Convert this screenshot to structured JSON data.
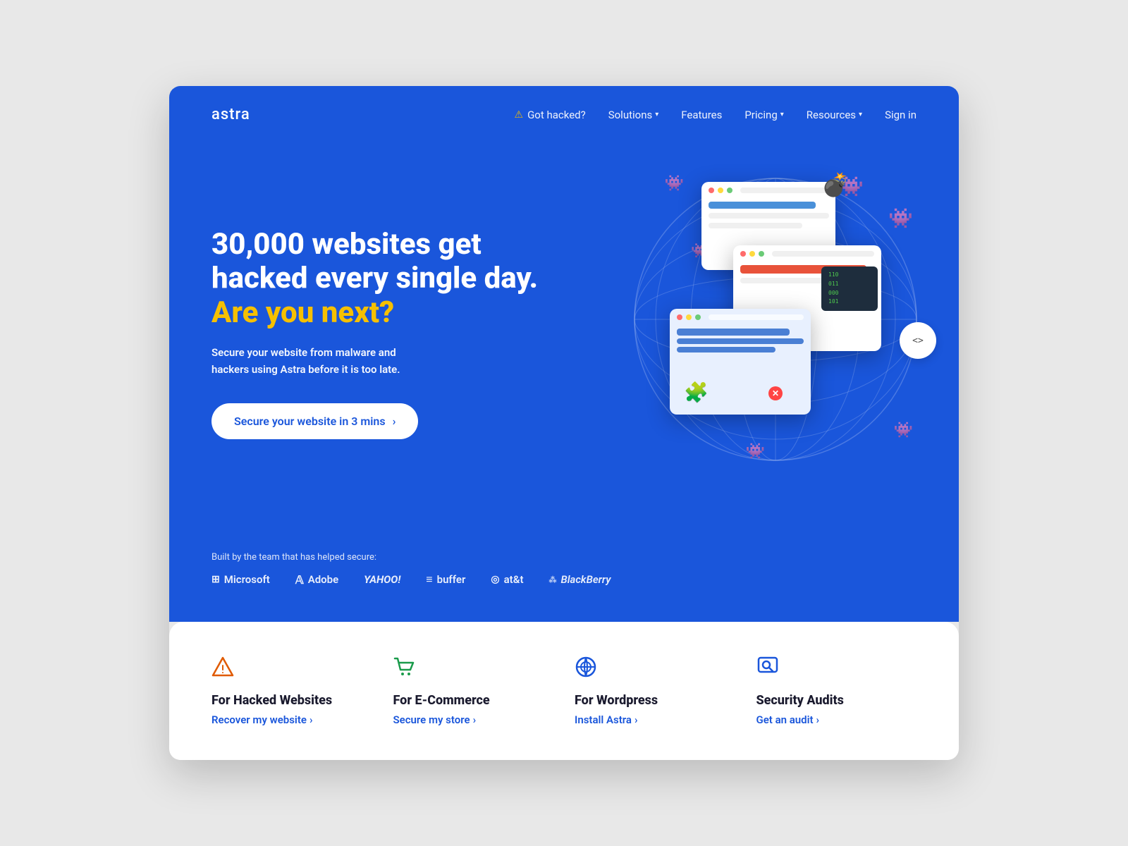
{
  "brand": {
    "logo": "astra"
  },
  "nav": {
    "got_hacked": "Got hacked?",
    "solutions": "Solutions",
    "features": "Features",
    "pricing": "Pricing",
    "resources": "Resources",
    "sign_in": "Sign in"
  },
  "hero": {
    "title_line1": "30,000 websites get",
    "title_line2": "hacked every single day.",
    "title_accent": "Are you next?",
    "subtitle": "Secure your website from malware and\nhackers using Astra before it is too late.",
    "cta_label": "Secure your website in 3 mins",
    "trusted_label": "Built by the team that has helped secure:",
    "trusted_logos": [
      {
        "name": "Microsoft",
        "icon": "⊞"
      },
      {
        "name": "Adobe"
      },
      {
        "name": "YAHOO!"
      },
      {
        "name": "buffer"
      },
      {
        "name": "at&t"
      },
      {
        "name": "BlackBerry"
      }
    ]
  },
  "features": [
    {
      "icon": "warning",
      "icon_color": "#e05a00",
      "title": "For Hacked Websites",
      "link_label": "Recover my website",
      "link_arrow": "›"
    },
    {
      "icon": "cart",
      "icon_color": "#1a9b4b",
      "title": "For E-Commerce",
      "link_label": "Secure my store",
      "link_arrow": "›"
    },
    {
      "icon": "wordpress",
      "icon_color": "#1a56db",
      "title": "For Wordpress",
      "link_label": "Install Astra",
      "link_arrow": "›"
    },
    {
      "icon": "search",
      "icon_color": "#1a56db",
      "title": "Security Audits",
      "link_label": "Get an audit",
      "link_arrow": "›"
    }
  ],
  "nav_arrow_label": "❯❮"
}
